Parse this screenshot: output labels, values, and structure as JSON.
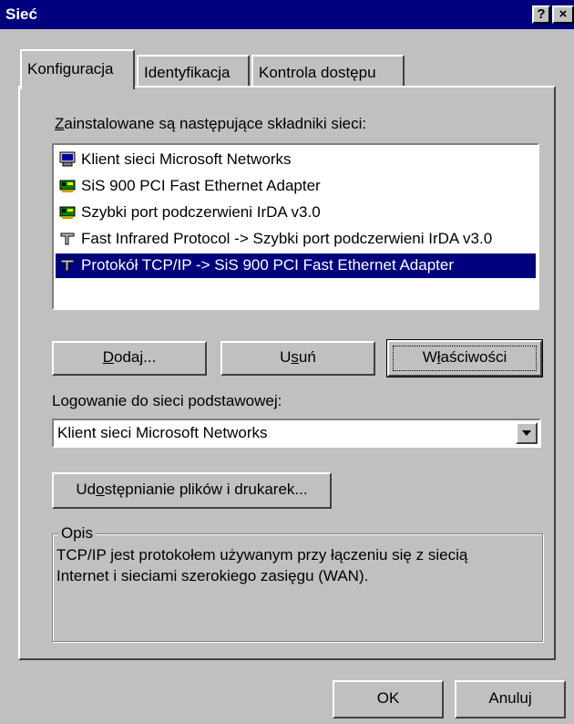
{
  "window": {
    "title": "Sieć",
    "help_label": "?",
    "close_label": "×"
  },
  "tabs": [
    {
      "label": "Konfiguracja",
      "active": true
    },
    {
      "label": "Identyfikacja",
      "active": false
    },
    {
      "label": "Kontrola dostępu",
      "active": false
    }
  ],
  "components": {
    "label_hotkey": "Z",
    "label_rest": "ainstalowane są następujące składniki sieci:",
    "items": [
      {
        "icon": "network-client-icon",
        "label": "Klient sieci Microsoft Networks",
        "selected": false
      },
      {
        "icon": "network-adapter-icon",
        "label": "SiS 900 PCI Fast Ethernet Adapter",
        "selected": false
      },
      {
        "icon": "network-adapter-icon",
        "label": "Szybki port podczerwieni IrDA v3.0",
        "selected": false
      },
      {
        "icon": "protocol-icon",
        "label": "Fast Infrared Protocol -> Szybki port podczerwieni IrDA v3.0",
        "selected": false
      },
      {
        "icon": "protocol-icon",
        "label": "Protokół TCP/IP -> SiS 900 PCI Fast Ethernet Adapter",
        "selected": true
      }
    ]
  },
  "buttons": {
    "add_hotkey": "D",
    "add_rest": "odaj...",
    "remove_pre": "U",
    "remove_hotkey": "s",
    "remove_rest": "uń",
    "props_pre": "W",
    "props_hotkey": "ł",
    "props_rest": "aściwości"
  },
  "logon": {
    "label": "Logowanie do sieci podstawowej:",
    "value": "Klient sieci Microsoft Networks"
  },
  "sharing": {
    "pre": "Ud",
    "hotkey": "o",
    "rest": "stępnianie plików i drukarek..."
  },
  "description": {
    "title": "Opis",
    "line1": "TCP/IP jest protokołem używanym przy łączeniu się z siecią",
    "line2": "Internet i sieciami szerokiego zasięgu (WAN)."
  },
  "footer": {
    "ok_label": "OK",
    "cancel_label": "Anuluj"
  },
  "colors": {
    "face": "#c0c0c0",
    "title_bar": "#00007e",
    "selection": "#00007e"
  }
}
